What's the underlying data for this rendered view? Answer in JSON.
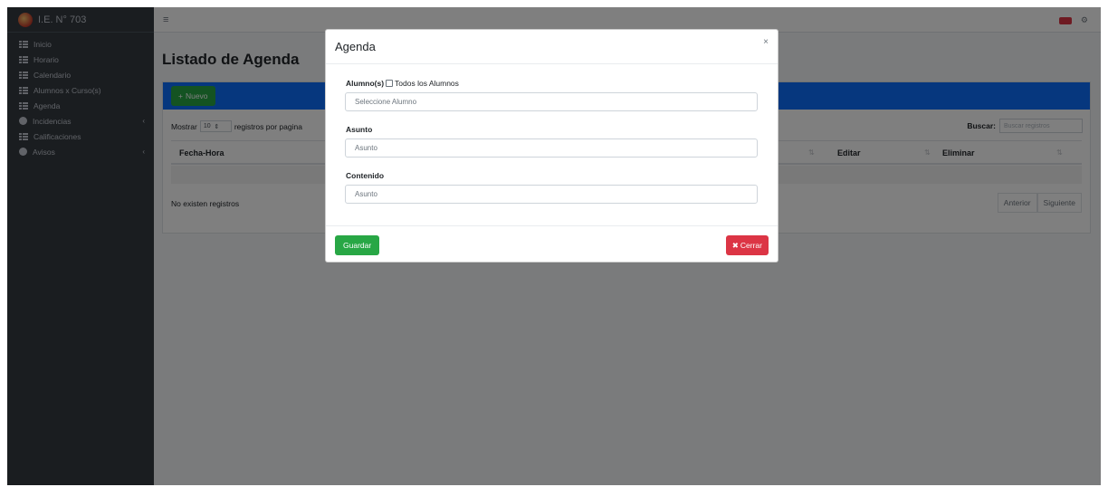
{
  "colors": {
    "sidebar_bg": "#343a40",
    "primary": "#0d6efd",
    "success": "#28a745",
    "danger": "#dc3545",
    "page_bg": "#f4f6f9"
  },
  "sidebar": {
    "brand": "I.E. N° 703",
    "items": [
      {
        "label": "Inicio",
        "icon": "grid-icon"
      },
      {
        "label": "Horario",
        "icon": "grid-icon"
      },
      {
        "label": "Calendario",
        "icon": "grid-icon"
      },
      {
        "label": "Alumnos x Curso(s)",
        "icon": "grid-icon"
      },
      {
        "label": "Agenda",
        "icon": "grid-icon"
      },
      {
        "label": "Incidencias",
        "icon": "users-icon",
        "arrow": "‹"
      },
      {
        "label": "Calificaciones",
        "icon": "grid-icon"
      },
      {
        "label": "Avisos",
        "icon": "users-icon",
        "arrow": "‹"
      }
    ]
  },
  "topbar": {
    "menu_icon": "≡",
    "settings_icon": "⚙"
  },
  "page": {
    "title": "Listado de Agenda",
    "new_button": "Nuevo",
    "new_icon": "+",
    "show_prefix": "Mostrar",
    "page_size": "10",
    "page_size_arrow": "⇕",
    "show_suffix": "registros por pagina",
    "search_label": "Buscar:",
    "search_placeholder": "Buscar registros",
    "columns": [
      "Fecha-Hora",
      "Editar",
      "Eliminar"
    ],
    "sort_icon": "⇅",
    "empty_text": "No existen registros",
    "prev": "Anterior",
    "next": "Siguiente"
  },
  "modal": {
    "title": "Agenda",
    "close": "×",
    "students_label": "Alumno(s)",
    "all_students_label": "Todos los Alumnos",
    "students_placeholder": "Seleccione Alumno",
    "subject_label": "Asunto",
    "subject_placeholder": "Asunto",
    "content_label": "Contenido",
    "content_placeholder": "Asunto",
    "save_button": "Guardar",
    "close_button": "Cerrar",
    "close_button_icon": "✖"
  }
}
